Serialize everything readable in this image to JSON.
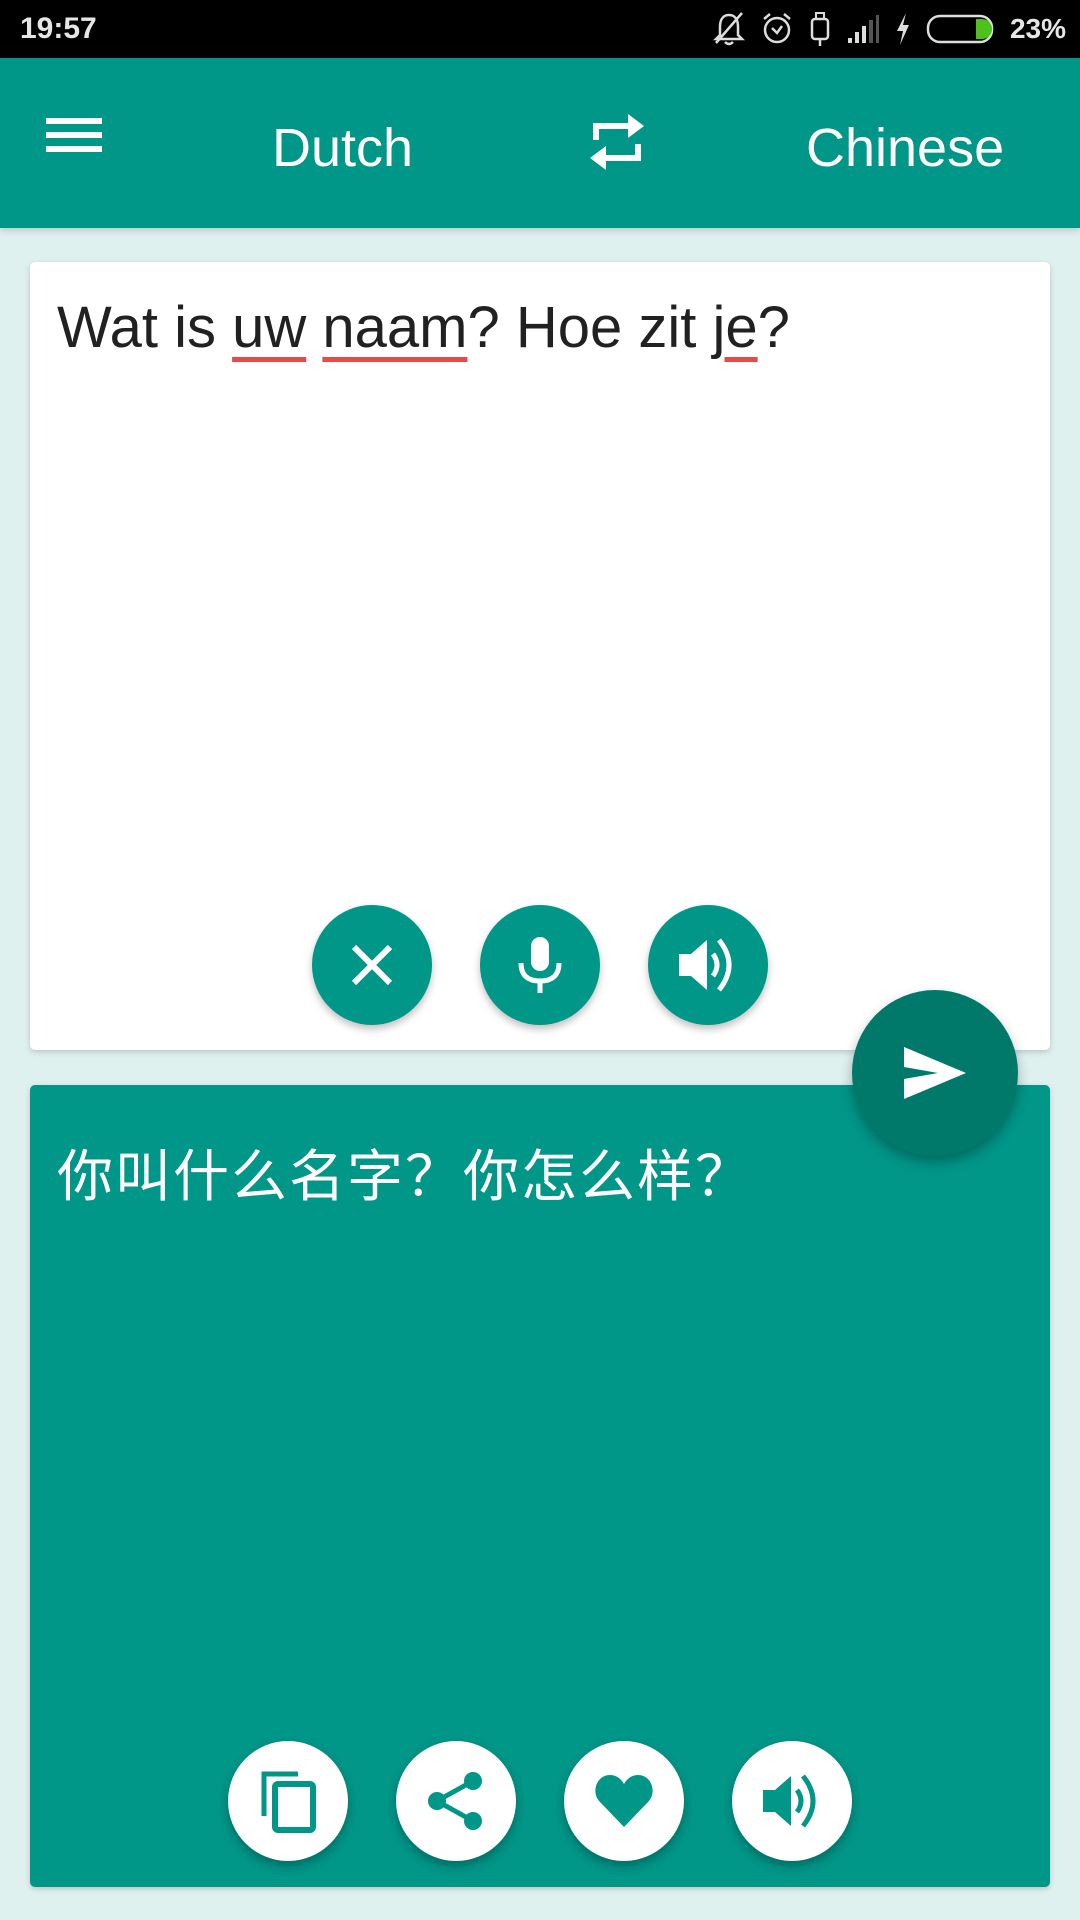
{
  "status_bar": {
    "time": "19:57",
    "icons": [
      "notifications-off-icon",
      "alarm-icon",
      "usb-icon",
      "signal-icon",
      "charging-icon",
      "battery-icon"
    ],
    "battery_percent": "23%",
    "battery_level": 0.23
  },
  "app_bar": {
    "menu_icon": "hamburger-menu-icon",
    "source_language": "Dutch",
    "swap_icon": "swap-languages-icon",
    "target_language": "Chinese"
  },
  "input": {
    "segments": [
      {
        "text": "Wat is ",
        "misspelled": false
      },
      {
        "text": "uw",
        "misspelled": true
      },
      {
        "text": " ",
        "misspelled": false
      },
      {
        "text": "naam",
        "misspelled": true
      },
      {
        "text": "? Hoe zit ",
        "misspelled": false
      },
      {
        "text": "je",
        "misspelled": true
      },
      {
        "text": "?",
        "misspelled": false
      }
    ],
    "actions": [
      "clear-icon",
      "microphone-icon",
      "speaker-icon"
    ]
  },
  "translate_button": {
    "icon": "send-icon"
  },
  "output": {
    "text": "你叫什么名字？你怎么样？",
    "actions": [
      "copy-icon",
      "share-icon",
      "favorite-heart-icon",
      "speaker-icon"
    ]
  },
  "colors": {
    "primary": "#009688",
    "primary_dark": "#00796b",
    "background": "#dff1ef",
    "spellcheck_underline": "#e84a4a"
  }
}
